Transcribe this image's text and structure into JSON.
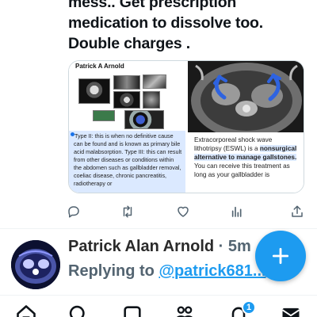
{
  "post": {
    "lines": [
      "mess.. Get prescription",
      "medication to dissolve too.",
      "Double charges ."
    ]
  },
  "media": {
    "left": {
      "header": "Patrick A Arnold",
      "caption": "Type II: this is when no definitive cause can be found and is known as primary bile acid malabsorption. Type III: this can result from other diseases or conditions within the abdomen such as gallbladder removal, coeliac disease, chronic pancreatitis, radiotherapy or"
    },
    "right": {
      "text_before": "Extracorporeal shock wave lithotripsy (ESWL) is a ",
      "text_highlight": "nonsurgical alternative to manage gallstones.",
      "text_after": " You can receive this treatment as long as your gallbladder is"
    }
  },
  "actions": {
    "reply": "reply-icon",
    "retweet": "retweet-icon",
    "like": "heart-icon",
    "views": "analytics-icon",
    "share": "share-icon"
  },
  "reply": {
    "name": "Patrick Alan Arnold",
    "meta": " · 5m",
    "prefix": "Replying to ",
    "handle": "@patrick681..."
  },
  "fab": {
    "icon": "plus-icon"
  },
  "tabs": {
    "home": "home-icon",
    "search": "search-icon",
    "communities": "communities-icon",
    "notifications": "bell-icon",
    "notifications_count": "1",
    "messages": "mail-icon"
  },
  "colors": {
    "accent": "#1d9bf0",
    "text": "#0f1419",
    "muted": "#536471",
    "highlight": "#dbe9ff"
  }
}
